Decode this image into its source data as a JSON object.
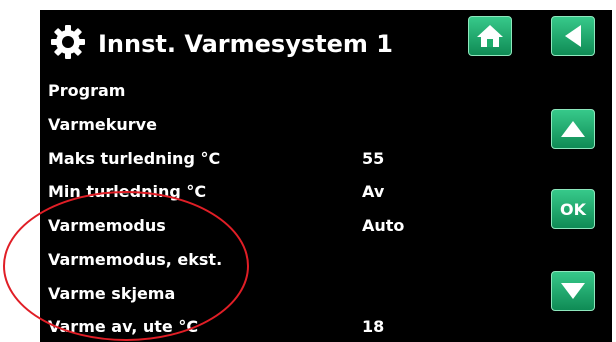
{
  "header": {
    "title": "Innst. Varmesystem 1",
    "icon": "gear-icon"
  },
  "buttons": {
    "home_icon": "home-icon",
    "back_icon": "back-arrow-icon",
    "up_icon": "up-arrow-icon",
    "ok_label": "OK",
    "down_icon": "down-arrow-icon"
  },
  "menu": {
    "items": [
      {
        "label": "Program",
        "value": ""
      },
      {
        "label": "Varmekurve",
        "value": ""
      },
      {
        "label": "Maks turledning °C",
        "value": "55"
      },
      {
        "label": "Min turledning °C",
        "value": "Av"
      },
      {
        "label": "Varmemodus",
        "value": "Auto"
      },
      {
        "label": "Varmemodus, ekst.",
        "value": ""
      },
      {
        "label": "Varme skjema",
        "value": ""
      },
      {
        "label": "Varme av, ute °C",
        "value": "18"
      }
    ]
  },
  "colors": {
    "screen_background": "#000000",
    "text": "#ffffff",
    "button_green": "#1fae6d",
    "annotation_red": "#e01e26"
  }
}
